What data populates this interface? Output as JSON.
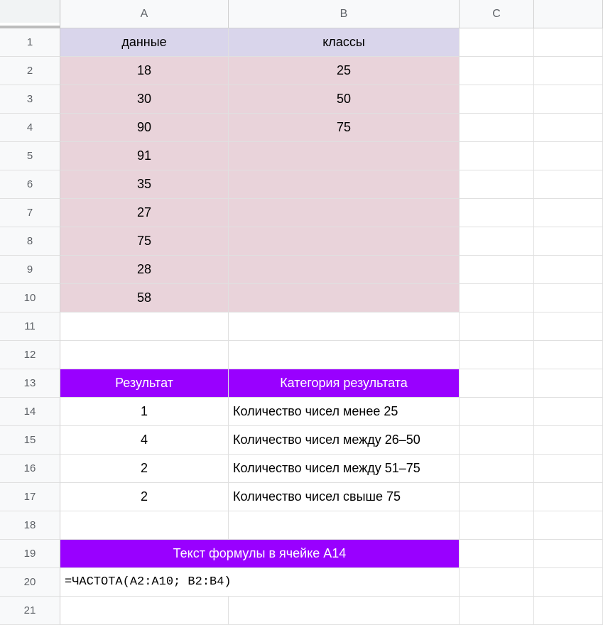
{
  "columns": {
    "a": "A",
    "b": "B",
    "c": "C"
  },
  "rows": [
    "1",
    "2",
    "3",
    "4",
    "5",
    "6",
    "7",
    "8",
    "9",
    "10",
    "11",
    "12",
    "13",
    "14",
    "15",
    "16",
    "17",
    "18",
    "19",
    "20",
    "21"
  ],
  "header1": {
    "a": "данные",
    "b": "классы"
  },
  "data_a": [
    "18",
    "30",
    "90",
    "91",
    "35",
    "27",
    "75",
    "28",
    "58"
  ],
  "data_b": [
    "25",
    "50",
    "75"
  ],
  "result_header": {
    "a": "Результат",
    "b": "Категория результата"
  },
  "results": [
    {
      "val": "1",
      "cat": "Количество чисел менее 25"
    },
    {
      "val": "4",
      "cat": "Количество чисел между 26–50"
    },
    {
      "val": "2",
      "cat": "Количество чисел между 51–75"
    },
    {
      "val": "2",
      "cat": "Количество чисел свыше 75"
    }
  ],
  "formula_header": "Текст формулы в ячейке A14",
  "formula": "=ЧАСТОТА(A2:A10; B2:B4)"
}
